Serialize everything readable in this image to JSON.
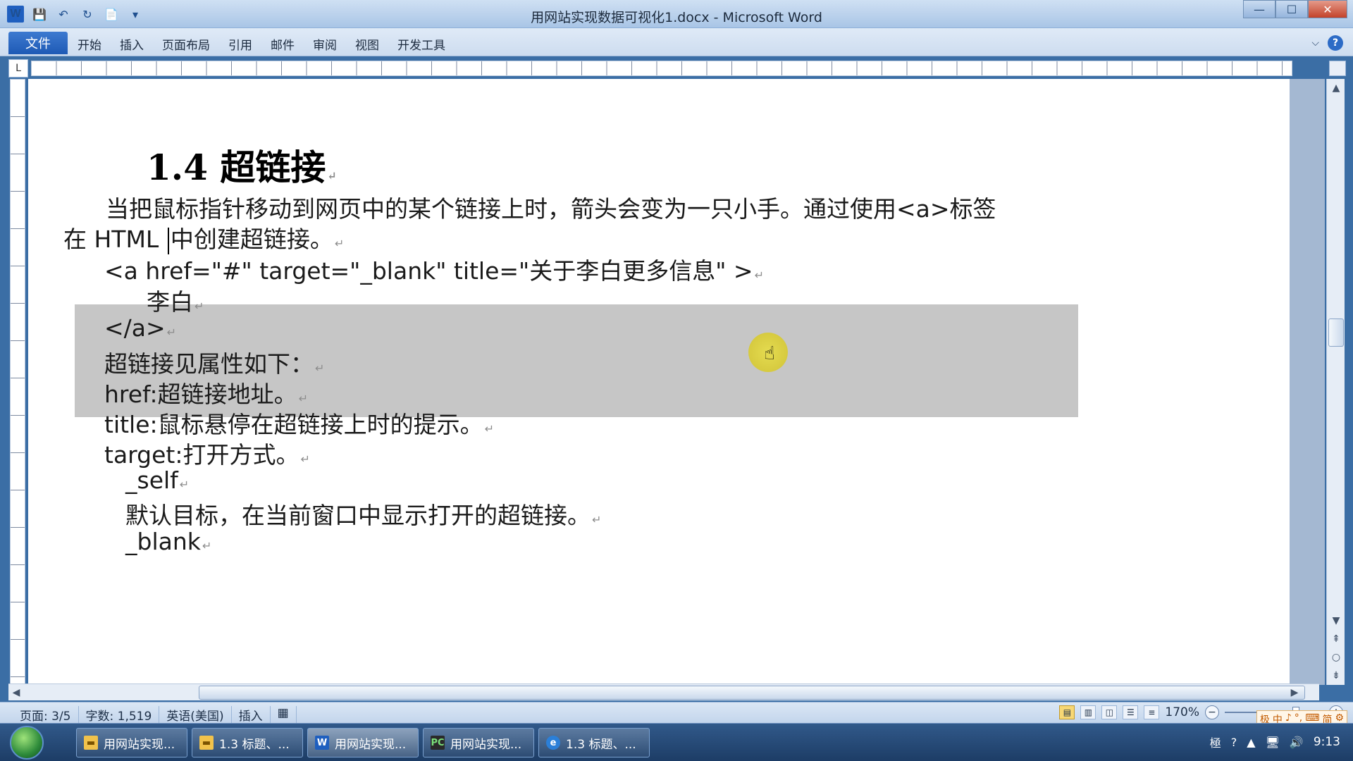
{
  "window": {
    "title": "用网站实现数据可视化1.docx - Microsoft Word",
    "qat": [
      "W",
      "💾",
      "↶",
      "↻",
      "📄",
      "▾"
    ]
  },
  "ribbon": {
    "file_tab": "文件",
    "tabs": [
      "开始",
      "插入",
      "页面布局",
      "引用",
      "邮件",
      "审阅",
      "视图",
      "开发工具"
    ]
  },
  "ruler": {
    "corner": "L"
  },
  "document": {
    "heading": "1.4 超链接",
    "intro_line1": "当把鼠标指针移动到网页中的某个链接上时，箭头会变为一只小手。通过使用<a>标签",
    "intro_line2a": "在 HTML",
    "intro_line2b": "中创建超链接。",
    "code_line1": "<a href=\"#\" target=\"_blank\" title=\"关于李白更多信息\" >",
    "code_line2": "李白",
    "code_line3": "</a>",
    "attr_title": "超链接见属性如下：",
    "href_line": "href:超链接地址。",
    "title_line": "title:鼠标悬停在超链接上时的提示。",
    "target_line": "target:打开方式。",
    "self_label": "_self",
    "self_desc": "默认目标，在当前窗口中显示打开的超链接。",
    "blank_label": "_blank",
    "para_mark": "↵"
  },
  "statusbar": {
    "page": "页面: 3/5",
    "words": "字数: 1,519",
    "language": "英语(美国)",
    "mode": "插入",
    "zoom": "170%",
    "ime": [
      "极",
      "中",
      "♪",
      "°,",
      "⌨",
      "简",
      "⚙"
    ]
  },
  "taskbar": {
    "buttons": [
      {
        "label": "用网站实现...",
        "icon": "folder-icon"
      },
      {
        "label": "1.3 标题、...",
        "icon": "folder-icon"
      },
      {
        "label": "用网站实现...",
        "icon": "word-icon"
      },
      {
        "label": "用网站实现...",
        "icon": "pycharm-icon"
      },
      {
        "label": "1.3 标题、...",
        "icon": "ie-icon"
      }
    ],
    "clock": "9:13"
  }
}
